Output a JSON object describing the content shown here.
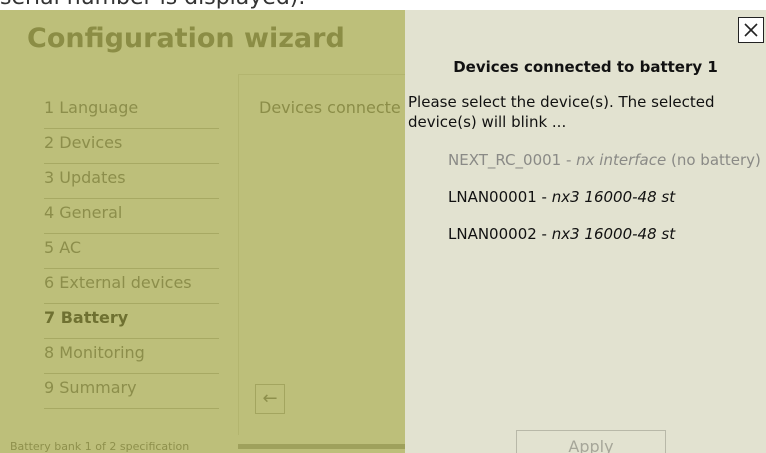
{
  "top_fragment": "serial number is displayed).",
  "wizard": {
    "title": "Configuration wizard",
    "steps": [
      {
        "label": "1 Language"
      },
      {
        "label": "2 Devices"
      },
      {
        "label": "3 Updates"
      },
      {
        "label": "4 General"
      },
      {
        "label": "5 AC"
      },
      {
        "label": "6 External devices"
      },
      {
        "label": "7 Battery",
        "active": true
      },
      {
        "label": "8 Monitoring"
      },
      {
        "label": "9 Summary"
      }
    ],
    "content_heading": "Devices connecte",
    "back_icon": "arrow-left-icon",
    "footnote": "Battery bank 1 of 2 specification"
  },
  "dialog": {
    "close_icon": "close-icon",
    "title": "Devices connected to battery 1",
    "instructions": "Please select the device(s). The selected device(s) will blink ...",
    "devices": [
      {
        "id": "NEXT_RC_0001",
        "sep": " - ",
        "model": "nx interface",
        "note": " (no battery)",
        "enabled": false
      },
      {
        "id": "LNAN00001",
        "sep": " - ",
        "model": "nx3 16000-48 st",
        "note": "",
        "enabled": true
      },
      {
        "id": "LNAN00002",
        "sep": " - ",
        "model": "nx3 16000-48 st",
        "note": "",
        "enabled": true
      }
    ],
    "apply_label": "Apply"
  }
}
